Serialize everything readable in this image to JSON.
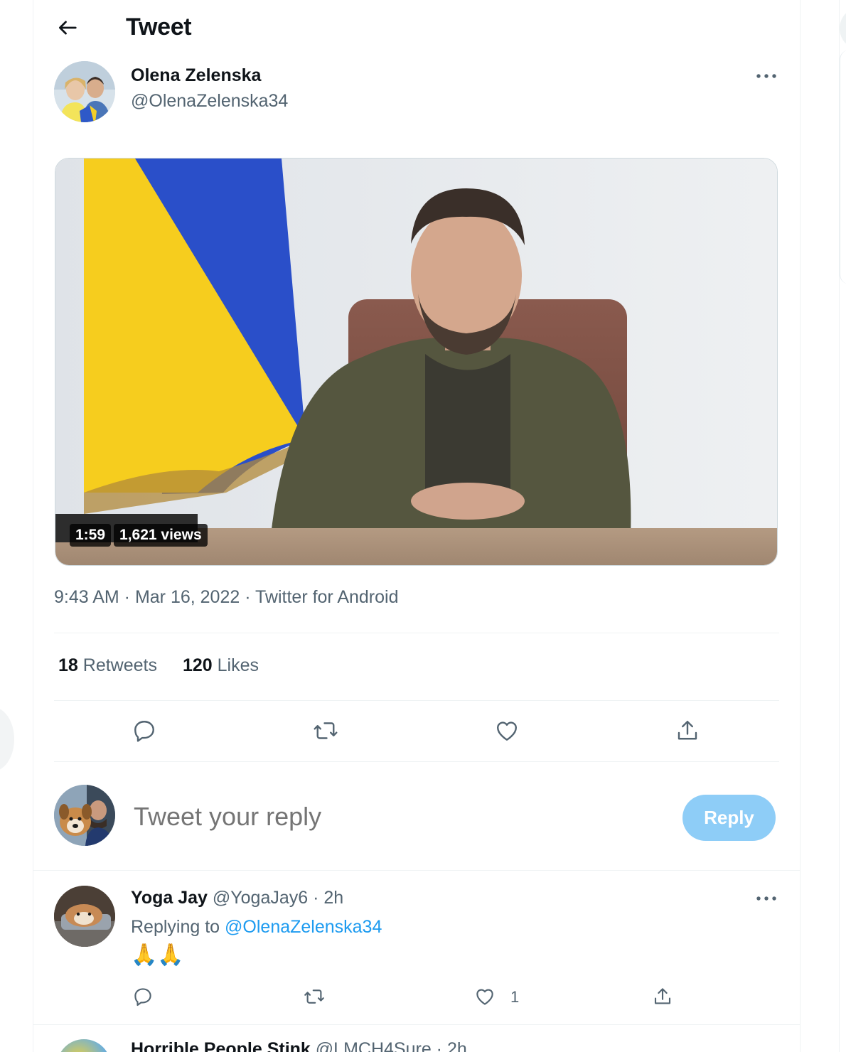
{
  "header": {
    "title": "Tweet",
    "back_icon": "arrow-left-icon"
  },
  "tweet": {
    "author": {
      "name": "Olena Zelenska",
      "handle": "@OlenaZelenska34"
    },
    "media": {
      "duration": "1:59",
      "views": "1,621 views"
    },
    "meta": "9:43 AM · Mar 16, 2022 · Twitter for Android",
    "stats": {
      "retweets_count": "18",
      "retweets_label": "Retweets",
      "likes_count": "120",
      "likes_label": "Likes"
    },
    "actions": [
      "reply-icon",
      "retweet-icon",
      "like-icon",
      "share-icon"
    ]
  },
  "composer": {
    "placeholder": "Tweet your reply",
    "button_label": "Reply"
  },
  "replies": [
    {
      "name": "Yoga Jay",
      "handle_time": "@YogaJay6 · 2h",
      "replying_prefix": "Replying to",
      "replying_to": "@OlenaZelenska34",
      "text": "🙏🙏",
      "like_count": "1"
    },
    {
      "name": "Horrible People Stink",
      "handle_time": "@LMCH4Sure · 2h"
    }
  ],
  "colors": {
    "accent": "#1d9bf0",
    "reply_button": "#8ecdf7",
    "secondary_text": "#536471",
    "flag_blue": "#2a4fc9",
    "flag_yellow": "#f6cd1e"
  }
}
